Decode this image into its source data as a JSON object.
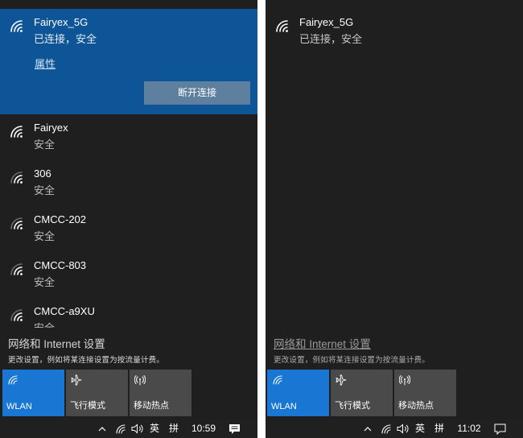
{
  "left": {
    "networks": [
      {
        "ssid": "Fairyex_5G",
        "status": "已连接，安全",
        "properties_link": "属性",
        "disconnect_label": "断开连接"
      },
      {
        "ssid": "Fairyex",
        "status": "安全"
      },
      {
        "ssid": "306",
        "status": "安全"
      },
      {
        "ssid": "CMCC-202",
        "status": "安全"
      },
      {
        "ssid": "CMCC-803",
        "status": "安全"
      },
      {
        "ssid": "CMCC-a9XU",
        "status": "安全"
      }
    ],
    "settings": {
      "link": "网络和 Internet 设置",
      "desc": "更改设置，例如将某连接设置为按流量计费。"
    },
    "tiles": [
      {
        "label": "WLAN",
        "icon": "wifi-icon",
        "active": true
      },
      {
        "label": "飞行模式",
        "icon": "airplane-icon",
        "active": false
      },
      {
        "label": "移动热点",
        "icon": "hotspot-icon",
        "active": false
      }
    ],
    "taskbar": {
      "ime": "英",
      "ime_mode": "拼",
      "clock": "10:59"
    }
  },
  "right": {
    "network": {
      "ssid": "Fairyex_5G",
      "status": "已连接，安全"
    },
    "settings": {
      "link": "网络和 Internet 设置",
      "desc": "更改设置，例如将某连接设置为按流量计费。"
    },
    "tiles": [
      {
        "label": "WLAN",
        "icon": "wifi-icon",
        "active": true
      },
      {
        "label": "飞行模式",
        "icon": "airplane-icon",
        "active": false
      },
      {
        "label": "移动热点",
        "icon": "hotspot-icon",
        "active": false
      }
    ],
    "taskbar": {
      "ime": "英",
      "ime_mode": "拼",
      "clock": "11:02"
    }
  },
  "colors": {
    "accent": "#1976d2",
    "selected_bg": "#0e5598",
    "panel_bg": "#1f1f1f",
    "tile_bg": "#4a4a4a"
  }
}
